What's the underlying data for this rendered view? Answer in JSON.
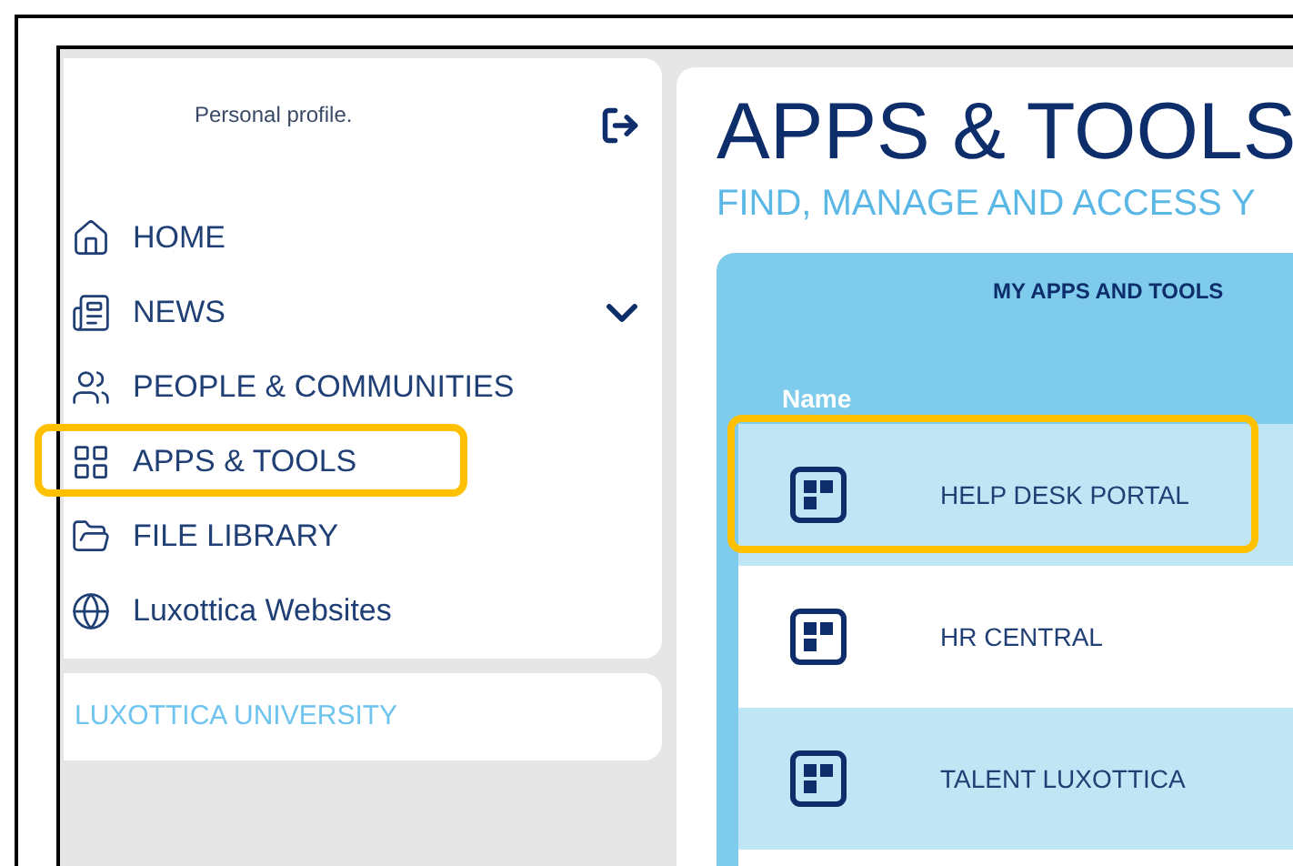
{
  "sidebar": {
    "profile_label": "Personal profile.",
    "nav_items": [
      {
        "label": "HOME",
        "has_submenu": false,
        "highlighted": false
      },
      {
        "label": "NEWS",
        "has_submenu": true,
        "highlighted": false
      },
      {
        "label": "PEOPLE & COMMUNITIES",
        "has_submenu": false,
        "highlighted": false
      },
      {
        "label": "APPS & TOOLS",
        "has_submenu": false,
        "highlighted": true
      },
      {
        "label": "FILE LIBRARY",
        "has_submenu": false,
        "highlighted": false
      },
      {
        "label": "Luxottica Websites",
        "has_submenu": false,
        "highlighted": false
      }
    ],
    "university_link": "LUXOTTICA UNIVERSITY"
  },
  "page": {
    "title": "APPS & TOOLS",
    "subtitle": "FIND, MANAGE AND ACCESS Y",
    "table": {
      "title": "MY APPS AND TOOLS",
      "columns": [
        "Name"
      ],
      "rows": [
        {
          "name": "HELP DESK PORTAL",
          "highlighted": true
        },
        {
          "name": "HR CENTRAL",
          "highlighted": false
        },
        {
          "name": "TALENT LUXOTTICA",
          "highlighted": false
        }
      ]
    }
  }
}
